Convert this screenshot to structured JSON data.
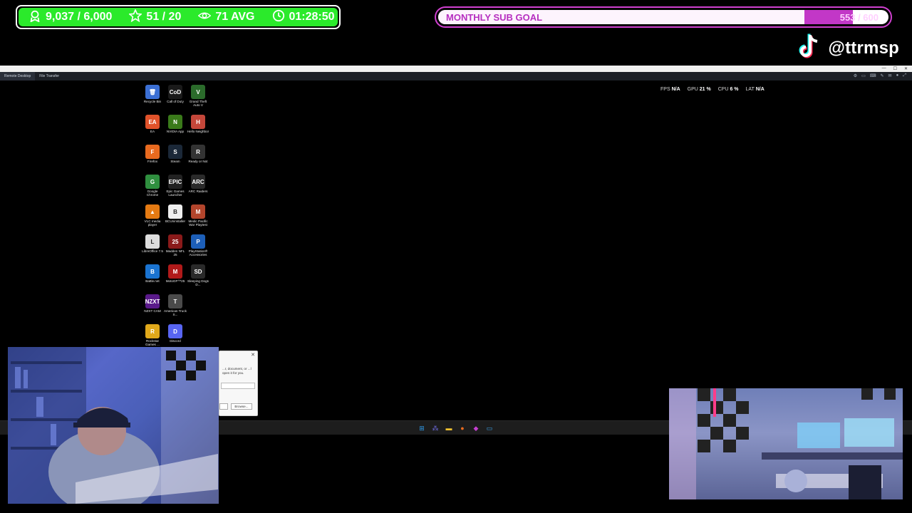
{
  "overlay": {
    "stats": [
      {
        "icon": "person-icon",
        "value": "9,037 / 6,000"
      },
      {
        "icon": "star-icon",
        "value": "51 / 20"
      },
      {
        "icon": "eye-icon",
        "value": "71 AVG"
      },
      {
        "icon": "timer-icon",
        "value": "01:28:50"
      }
    ],
    "accent_green": "#2bea2b",
    "sub_goal": {
      "title": "MONTHLY SUB GOAL",
      "count": "553 / 600",
      "current": 553,
      "target": 600,
      "accent": "#c237c7"
    },
    "tiktok": {
      "icon": "tiktok-icon",
      "handle": "@ttrmsp"
    }
  },
  "remote": {
    "tabs": [
      "Remote Desktop",
      "File Transfer"
    ],
    "perf": [
      {
        "label": "FPS",
        "value": "N/A"
      },
      {
        "label": "GPU",
        "value": "21 %"
      },
      {
        "label": "CPU",
        "value": "6 %"
      },
      {
        "label": "LAT",
        "value": "N/A"
      }
    ]
  },
  "desktop_icons": [
    {
      "label": "Recycle Bin",
      "color": "#3b6fd4",
      "glyph": "🗑"
    },
    {
      "label": "Call of Duty",
      "color": "#1a1a1a",
      "glyph": "CoD"
    },
    {
      "label": "Grand Theft Auto V",
      "color": "#2b6b2b",
      "glyph": "V"
    },
    {
      "label": "EA",
      "color": "#e0522a",
      "glyph": "EA"
    },
    {
      "label": "NVIDIA App",
      "color": "#3a7a1a",
      "glyph": "N"
    },
    {
      "label": "Hello Neighbor",
      "color": "#c4473a",
      "glyph": "H"
    },
    {
      "label": "Firefox",
      "color": "#e86a1f",
      "glyph": "F"
    },
    {
      "label": "Steam",
      "color": "#1b2838",
      "glyph": "S"
    },
    {
      "label": "Ready or Not",
      "color": "#333333",
      "glyph": "R"
    },
    {
      "label": "Google Chrome",
      "color": "#2f8f3f",
      "glyph": "G"
    },
    {
      "label": "Epic Games Launcher",
      "color": "#222222",
      "glyph": "EPIC"
    },
    {
      "label": "ARC Raiders",
      "color": "#2a2a2a",
      "glyph": "ARC"
    },
    {
      "label": "VLC media player",
      "color": "#e57a12",
      "glyph": "▲"
    },
    {
      "label": "BCUninstaller",
      "color": "#eeeeee",
      "glyph": "B"
    },
    {
      "label": "Medic Pacific War Playtest",
      "color": "#b3452c",
      "glyph": "M"
    },
    {
      "label": "LibreOffice 7.5",
      "color": "#dddddd",
      "glyph": "L"
    },
    {
      "label": "Madden NFL 25",
      "color": "#8a1a1a",
      "glyph": "25"
    },
    {
      "label": "PlayStation® Accessories",
      "color": "#1d5fb8",
      "glyph": "P"
    },
    {
      "label": "Battle.net",
      "color": "#1a73d0",
      "glyph": "B"
    },
    {
      "label": "MotoGP™25",
      "color": "#b01a1a",
      "glyph": "M"
    },
    {
      "label": "Sleeping Dogs D...",
      "color": "#2a2a2a",
      "glyph": "SD"
    },
    {
      "label": "NZXT CAM",
      "color": "#5a1a8a",
      "glyph": "NZXT"
    },
    {
      "label": "American Truck S...",
      "color": "#4a4a4a",
      "glyph": "T"
    },
    {
      "label": "",
      "color": "transparent",
      "glyph": ""
    },
    {
      "label": "Rockstar Games ...",
      "color": "#e0a81a",
      "glyph": "R"
    },
    {
      "label": "Discord",
      "color": "#5865f2",
      "glyph": "D"
    }
  ],
  "dialog": {
    "text": "...r, document, or ...l open it for you.",
    "browse": "Browse..."
  },
  "taskbar": {
    "icons": [
      {
        "name": "start-icon",
        "color": "#2f9bea",
        "glyph": "⊞"
      },
      {
        "name": "teams-icon",
        "color": "#6b68d8",
        "glyph": "⁂"
      },
      {
        "name": "explorer-icon",
        "color": "#f2c230",
        "glyph": "▬"
      },
      {
        "name": "firefox-icon",
        "color": "#e86a1f",
        "glyph": "●"
      },
      {
        "name": "app-icon",
        "color": "#c53fd0",
        "glyph": "◆"
      },
      {
        "name": "run-icon",
        "color": "#3aa0e8",
        "glyph": "▭"
      }
    ]
  }
}
